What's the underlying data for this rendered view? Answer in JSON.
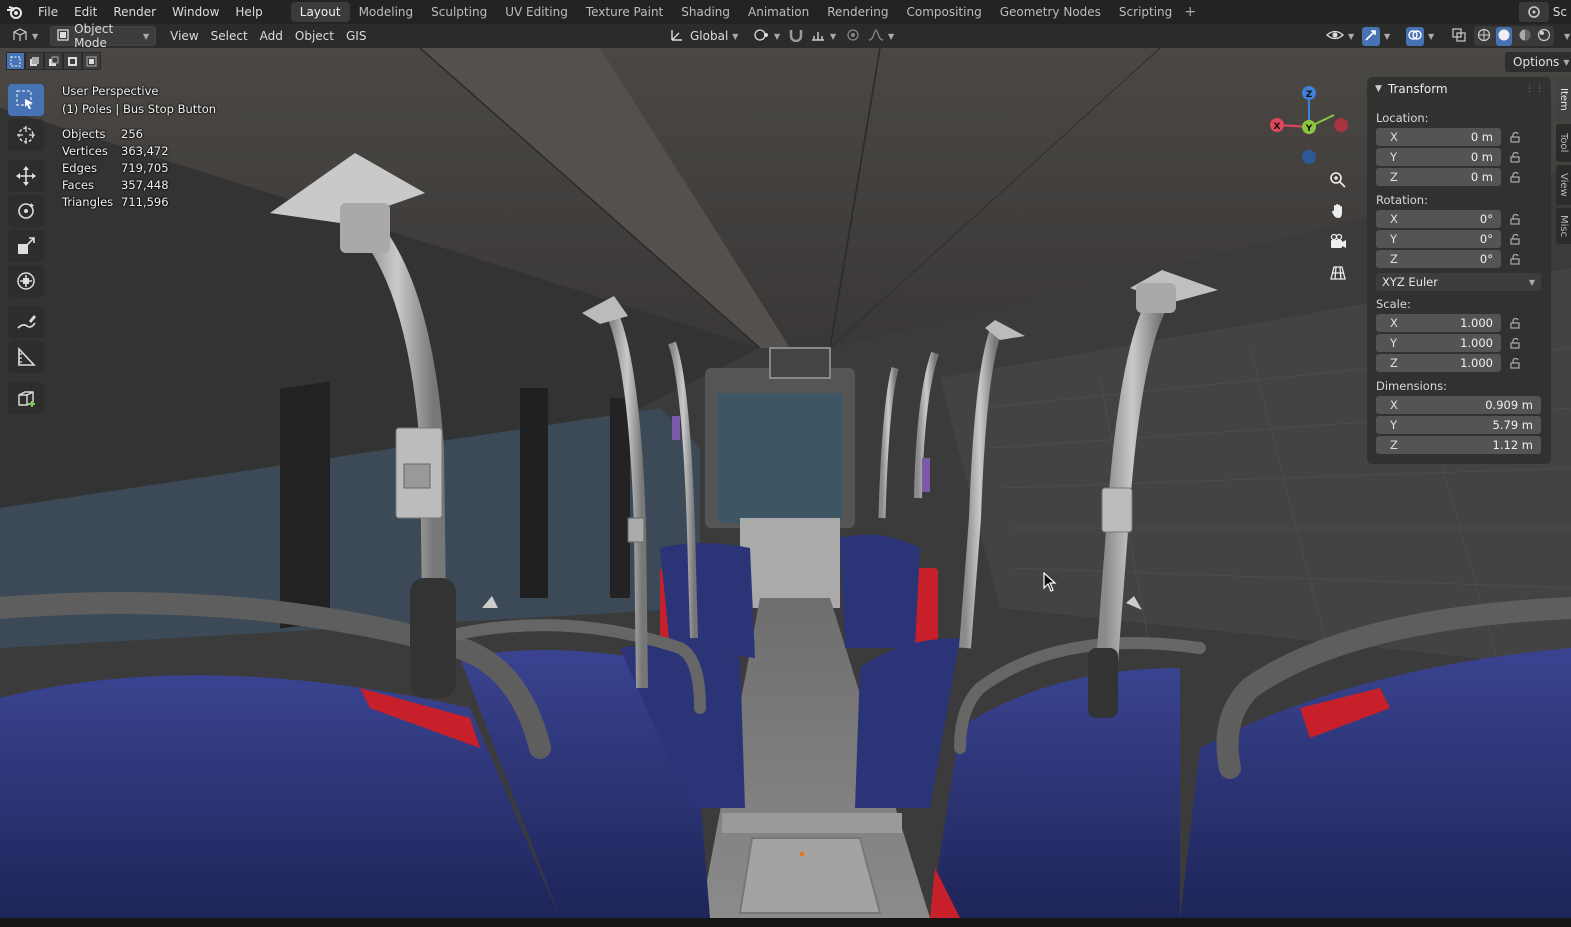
{
  "topbar": {
    "menus": [
      "File",
      "Edit",
      "Render",
      "Window",
      "Help"
    ],
    "workspaces": [
      "Layout",
      "Modeling",
      "Sculpting",
      "UV Editing",
      "Texture Paint",
      "Shading",
      "Animation",
      "Rendering",
      "Compositing",
      "Geometry Nodes",
      "Scripting"
    ],
    "active_workspace": "Layout",
    "add_workspace": "+",
    "right_label": "Sc"
  },
  "header": {
    "mode": "Object Mode",
    "menus": [
      "View",
      "Select",
      "Add",
      "Object",
      "GIS"
    ],
    "orientation": "Global",
    "options_label": "Options"
  },
  "viewport": {
    "perspective": "User Perspective",
    "active_object": "(1) Poles | Bus Stop Button",
    "stats": [
      {
        "label": "Objects",
        "value": "256"
      },
      {
        "label": "Vertices",
        "value": "363,472"
      },
      {
        "label": "Edges",
        "value": "719,705"
      },
      {
        "label": "Faces",
        "value": "357,448"
      },
      {
        "label": "Triangles",
        "value": "711,596"
      }
    ],
    "gizmo": {
      "x": "X",
      "y": "Y",
      "z": "Z"
    }
  },
  "tools": [
    "select-box-icon",
    "cursor-icon",
    "move-icon",
    "rotate-icon",
    "scale-icon",
    "transform-icon",
    "annotate-icon",
    "measure-icon",
    "add-cube-icon"
  ],
  "npanel": {
    "title": "Transform",
    "location_label": "Location:",
    "location": [
      {
        "axis": "X",
        "value": "0 m"
      },
      {
        "axis": "Y",
        "value": "0 m"
      },
      {
        "axis": "Z",
        "value": "0 m"
      }
    ],
    "rotation_label": "Rotation:",
    "rotation": [
      {
        "axis": "X",
        "value": "0°"
      },
      {
        "axis": "Y",
        "value": "0°"
      },
      {
        "axis": "Z",
        "value": "0°"
      }
    ],
    "rotation_mode": "XYZ Euler",
    "scale_label": "Scale:",
    "scale": [
      {
        "axis": "X",
        "value": "1.000"
      },
      {
        "axis": "Y",
        "value": "1.000"
      },
      {
        "axis": "Z",
        "value": "1.000"
      }
    ],
    "dimensions_label": "Dimensions:",
    "dimensions": [
      {
        "axis": "X",
        "value": "0.909 m"
      },
      {
        "axis": "Y",
        "value": "5.79 m"
      },
      {
        "axis": "Z",
        "value": "1.12 m"
      }
    ]
  },
  "sidebar_tabs": [
    "Item",
    "Tool",
    "View",
    "Misc"
  ],
  "colors": {
    "accent": "#4772b3",
    "axis_x": "#e0475a",
    "axis_y": "#8cc63f",
    "axis_z": "#3b82d8",
    "seat_blue": "#2a3375",
    "seat_red": "#c8202a"
  }
}
